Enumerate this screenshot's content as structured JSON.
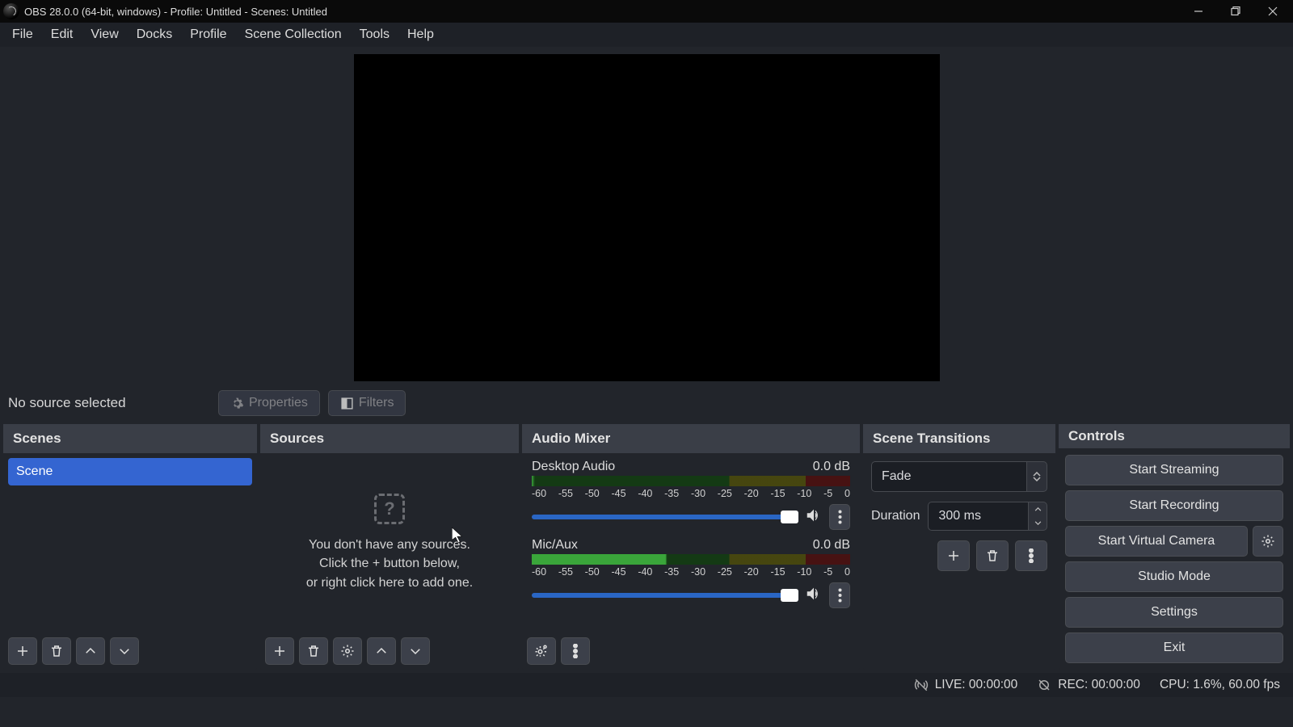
{
  "window": {
    "title": "OBS 28.0.0 (64-bit, windows) - Profile: Untitled - Scenes: Untitled"
  },
  "menu": {
    "items": [
      "File",
      "Edit",
      "View",
      "Docks",
      "Profile",
      "Scene Collection",
      "Tools",
      "Help"
    ]
  },
  "infobar": {
    "status": "No source selected",
    "properties": "Properties",
    "filters": "Filters"
  },
  "panels": {
    "scenes": {
      "title": "Scenes",
      "items": [
        "Scene"
      ]
    },
    "sources": {
      "title": "Sources",
      "empty_line1": "You don't have any sources.",
      "empty_line2": "Click the + button below,",
      "empty_line3": "or right click here to add one."
    },
    "mixer": {
      "title": "Audio Mixer",
      "ticks": [
        "-60",
        "-55",
        "-50",
        "-45",
        "-40",
        "-35",
        "-30",
        "-25",
        "-20",
        "-15",
        "-10",
        "-5",
        "0"
      ],
      "channels": [
        {
          "name": "Desktop Audio",
          "level": "0.0 dB"
        },
        {
          "name": "Mic/Aux",
          "level": "0.0 dB"
        }
      ]
    },
    "transitions": {
      "title": "Scene Transitions",
      "type": "Fade",
      "duration_label": "Duration",
      "duration_value": "300 ms"
    },
    "controls": {
      "title": "Controls",
      "start_streaming": "Start Streaming",
      "start_recording": "Start Recording",
      "start_vcam": "Start Virtual Camera",
      "studio_mode": "Studio Mode",
      "settings": "Settings",
      "exit": "Exit"
    }
  },
  "status": {
    "live": "LIVE: 00:00:00",
    "rec": "REC: 00:00:00",
    "cpu": "CPU: 1.6%, 60.00 fps"
  }
}
